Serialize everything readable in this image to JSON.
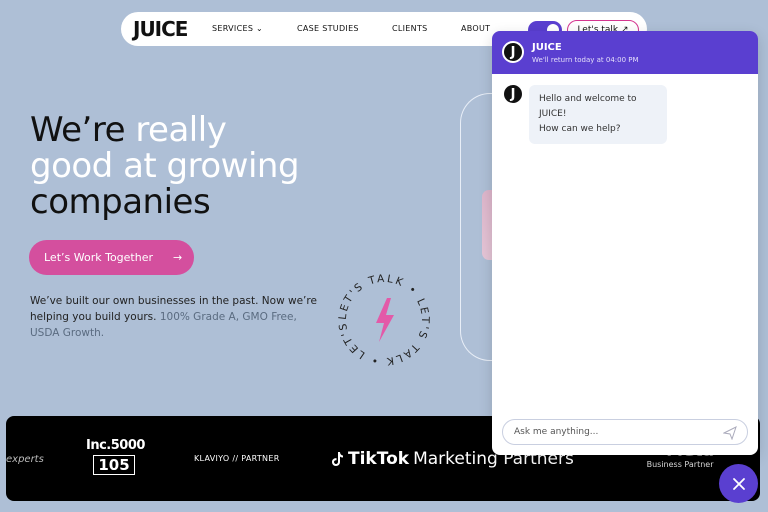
{
  "nav": {
    "logo": "JUICE",
    "links": [
      "SERVICES ⌄",
      "CASE STUDIES",
      "CLIENTS",
      "ABOUT"
    ],
    "talk_label": "Let's talk ↗"
  },
  "hero": {
    "line1_dark": "We’re ",
    "line1_light": "really",
    "line2_light": "good at growing",
    "line3_dark": "companies",
    "cta_label": "Let’s Work Together",
    "cta_arrow": "→",
    "desc": "We’ve built our own businesses in the past. Now we’re helping you build yours.",
    "desc_muted": "100% Grade A, GMO Free, USDA Growth."
  },
  "stamp": {
    "text": "LET'S TALK • LET'S TALK • LET'S TALK •"
  },
  "partners": {
    "experts": "experts",
    "inc_top": "Inc.5000",
    "inc_num": "105",
    "klaviyo": "KLAVIYO // PARTNER",
    "tiktok_bold": "TikTok",
    "tiktok_rest": "Marketing Partners",
    "meta_logo": "∞ Meta",
    "meta_sub": "Business Partner"
  },
  "chat": {
    "name": "JUICE",
    "status": "We'll return today at 04:00 PM",
    "avatar_letter": "J",
    "message_line1": "Hello and welcome to JUICE!",
    "message_line2": "How can we help?",
    "input_placeholder": "Ask me anything..."
  },
  "colors": {
    "background": "#aebfd6",
    "accent_purple": "#5a3fd0",
    "cta_pink": "#d44f9e"
  }
}
